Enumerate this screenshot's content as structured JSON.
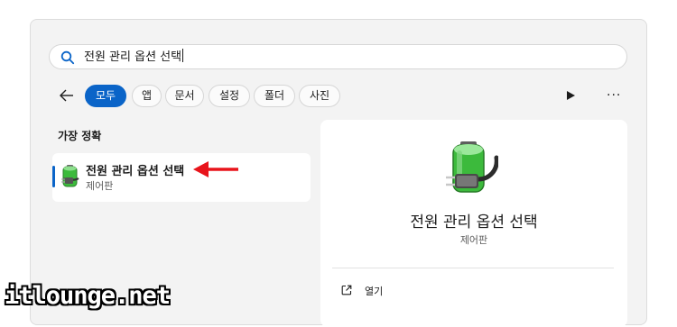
{
  "search": {
    "query": "전원 관리 옵션 선택",
    "icon": "search-icon"
  },
  "filters": {
    "tabs": [
      {
        "label": "모두",
        "active": true
      },
      {
        "label": "앱",
        "active": false
      },
      {
        "label": "문서",
        "active": false
      },
      {
        "label": "설정",
        "active": false
      },
      {
        "label": "폴더",
        "active": false
      },
      {
        "label": "사진",
        "active": false
      }
    ],
    "more_label": "···"
  },
  "best_match": {
    "section_title": "가장 정확",
    "title": "전원 관리 옵션 선택",
    "subtitle": "제어판",
    "icon": "battery-plug-icon"
  },
  "detail": {
    "title": "전원 관리 옵션 선택",
    "subtitle": "제어판",
    "actions": [
      {
        "label": "열기",
        "icon": "open-external-icon"
      }
    ]
  },
  "watermark": "itlounge.net",
  "colors": {
    "accent": "#0a64c8",
    "annotation_arrow": "#e8141b",
    "battery_green": "#3cba3c"
  }
}
